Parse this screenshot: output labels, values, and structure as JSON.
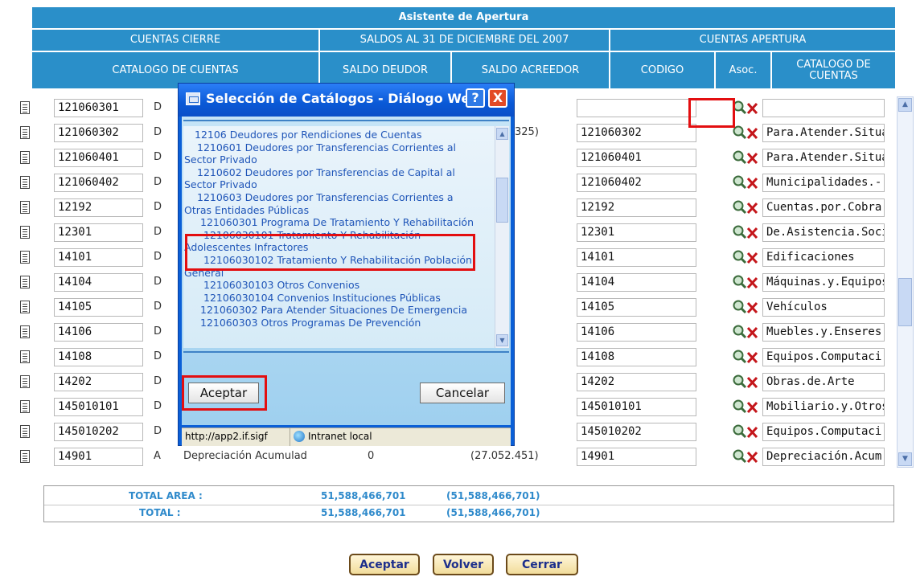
{
  "header": {
    "title": "Asistente de Apertura",
    "group_close": "CUENTAS CIERRE",
    "group_balances": "SALDOS AL 31 DE DICIEMBRE DEL 2007",
    "group_open": "CUENTAS APERTURA",
    "col_catalog": "CATALOGO DE CUENTAS",
    "col_debit": "SALDO DEUDOR",
    "col_credit": "SALDO ACREEDOR",
    "col_code": "CODIGO",
    "col_assoc": "Asoc.",
    "col_catalog2_line1": "CATALOGO DE",
    "col_catalog2_line2": "CUENTAS"
  },
  "rows": [
    {
      "account": "121060301",
      "type": "D",
      "code": "",
      "name": ""
    },
    {
      "account": "121060302",
      "type": "D",
      "credit": "325)",
      "code": "121060302",
      "name": "Para.Atender.Situa"
    },
    {
      "account": "121060401",
      "type": "D",
      "code": "121060401",
      "name": "Para.Atender.Situa"
    },
    {
      "account": "121060402",
      "type": "D",
      "code": "121060402",
      "name": "Municipalidades.-.P"
    },
    {
      "account": "12192",
      "type": "D",
      "code": "12192",
      "name": "Cuentas.por.Cobra"
    },
    {
      "account": "12301",
      "type": "D",
      "code": "12301",
      "name": "De.Asistencia.Socia"
    },
    {
      "account": "14101",
      "type": "D",
      "code": "14101",
      "name": "Edificaciones"
    },
    {
      "account": "14104",
      "type": "D",
      "code": "14104",
      "name": "Máquinas.y.Equipos"
    },
    {
      "account": "14105",
      "type": "D",
      "code": "14105",
      "name": "Vehículos"
    },
    {
      "account": "14106",
      "type": "D",
      "code": "14106",
      "name": "Muebles.y.Enseres"
    },
    {
      "account": "14108",
      "type": "D",
      "code": "14108",
      "name": "Equipos.Computaci"
    },
    {
      "account": "14202",
      "type": "D",
      "code": "14202",
      "name": "Obras.de.Arte"
    },
    {
      "account": "145010101",
      "type": "D",
      "code": "145010101",
      "name": "Mobiliario.y.Otros"
    },
    {
      "account": "145010202",
      "type": "D",
      "code": "145010202",
      "name": "Equipos.Computaci"
    },
    {
      "account": "14901",
      "type": "A",
      "desc": "Depreciación Acumulad",
      "debit": "0",
      "credit": "(27.052.451)",
      "code": "14901",
      "name": "Depreciación.Acum"
    }
  ],
  "totals": {
    "area_label": "TOTAL AREA :",
    "area_debit": "51,588,466,701",
    "area_credit": "(51,588,466,701)",
    "total_label": "TOTAL :",
    "total_debit": "51,588,466,701",
    "total_credit": "(51,588,466,701)"
  },
  "buttons": {
    "accept": "Aceptar",
    "back": "Volver",
    "close": "Cerrar"
  },
  "dialog": {
    "title": "Selección de Catálogos - Diálogo Web",
    "help": "?",
    "close": "X",
    "items": [
      "12106 Deudores por Rendiciones de Cuentas",
      "1210601 Deudores por Transferencias Corrientes al",
      "Sector Privado",
      "1210602 Deudores por Transferencias de Capital al",
      "Sector Privado",
      "1210603 Deudores por Transferencias Corrientes a",
      "Otras Entidades Públicas",
      "121060301 Programa De Tratamiento Y Rehabilitación",
      "12106030101 Tratamiento Y Rehabilitación",
      "Adolescentes Infractores",
      "12106030102 Tratamiento Y Rehabilitación Población",
      "General",
      "12106030103 Otros Convenios",
      "12106030104 Convenios Instituciones Públicas",
      "121060302 Para Atender Situaciones De Emergencia",
      "121060303 Otros Programas De Prevención"
    ],
    "accept": "Aceptar",
    "cancel": "Cancelar",
    "status_url": "http://app2.if.sigf",
    "status_zone": "Intranet local"
  },
  "colors": {
    "header_blue": "#2a8fc9",
    "dialog_blue": "#0a5fd7",
    "highlight_red": "#e30e10",
    "totals_blue": "#2f8acb"
  }
}
